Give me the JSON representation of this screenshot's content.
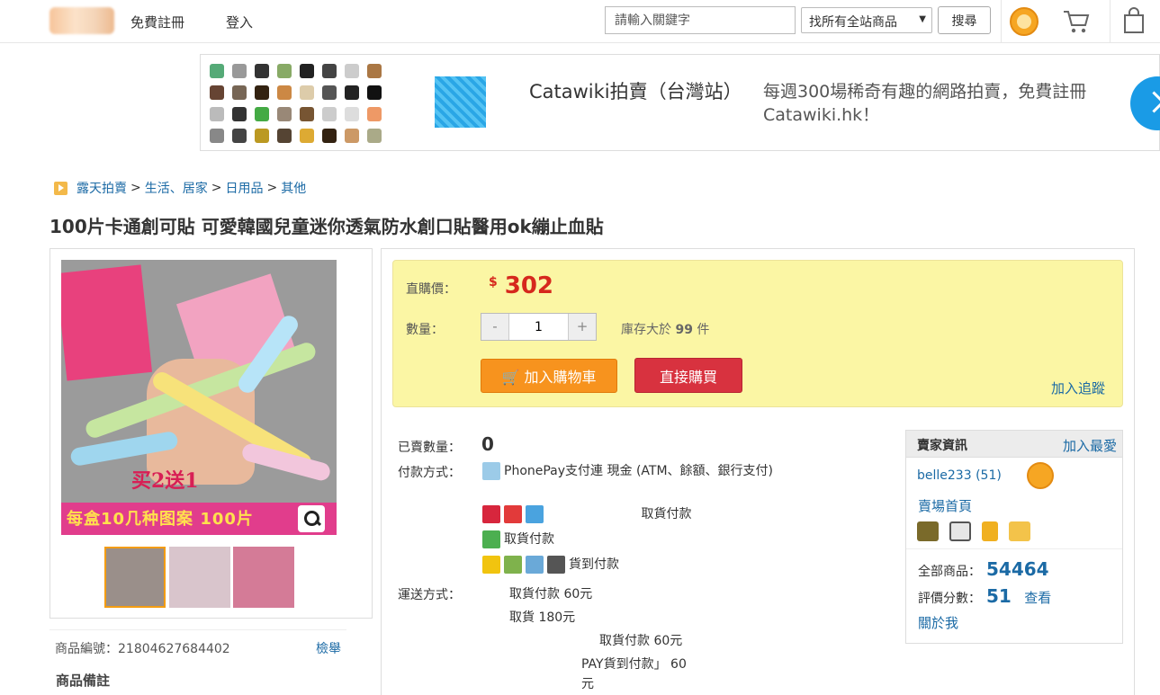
{
  "header": {
    "register": "免費註冊",
    "login": "登入",
    "search_placeholder": "請輸入關鍵字",
    "scope": "找所有全站商品",
    "search_btn": "搜尋"
  },
  "banner": {
    "title": "Catawiki拍賣（台灣站）",
    "desc": "每週300場稀奇有趣的網路拍賣，免費註冊Catawiki.hk！"
  },
  "breadcrumb": {
    "root": "露天拍賣",
    "c1": "生活、居家",
    "c2": "日用品",
    "c3": "其他",
    "sep": ">"
  },
  "title": "100片卡通創可貼 可愛韓國兒童迷你透氣防水創口貼醫用ok繃止血貼",
  "product_image": {
    "promo": "买2送1",
    "promo2": "每盒10几种图案 100片"
  },
  "sku": {
    "label": "商品編號：",
    "value": "21804627684402",
    "report": "檢舉"
  },
  "notes_title": "商品備註",
  "buybox": {
    "price_label": "直購價：",
    "currency": "$",
    "price": "302",
    "qty_label": "數量：",
    "qty_minus": "-",
    "qty_value": "1",
    "qty_plus": "+",
    "stock_pre": "庫存大於",
    "stock_num": "99",
    "stock_unit": "件",
    "add_cart": "加入購物車",
    "buy_now": "直接購買",
    "track": "加入追蹤"
  },
  "info": {
    "sold_label": "已賣數量：",
    "sold": "0",
    "pay_label": "付款方式：",
    "pay1": "PhonePay支付連 現金 (ATM、餘額、銀行支付)",
    "pay2": "取貨付款",
    "pay3": "取貨付款",
    "pay4": "貨到付款",
    "ship_label": "運送方式：",
    "ship1": "取貨付款 60元",
    "ship2": "取貨 180元",
    "ship3": "取貨付款 60元",
    "ship4": "PAY貨到付款」 60元"
  },
  "seller": {
    "head": "賣家資訊",
    "fav": "加入最愛",
    "name": "belle233",
    "rating_count": "(51)",
    "shop": "賣場首頁",
    "all_label": "全部商品：",
    "all_value": "54464",
    "score_label": "評價分數：",
    "score_value": "51",
    "look": "查看",
    "about": "關於我"
  }
}
